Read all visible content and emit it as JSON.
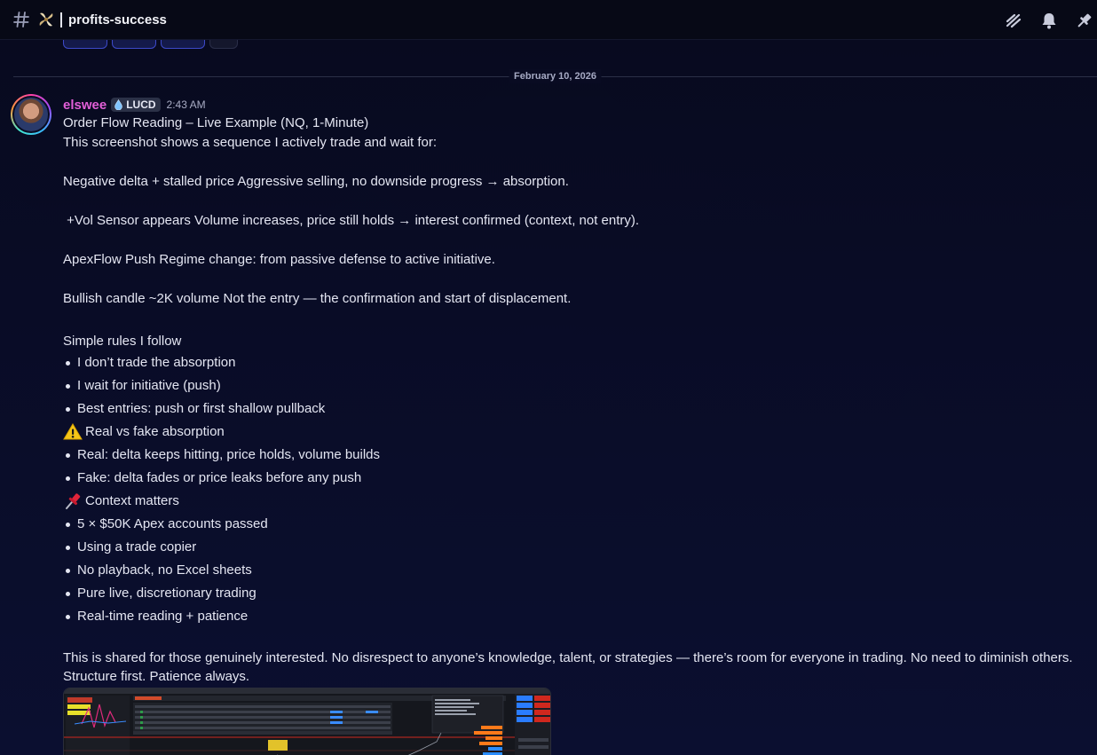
{
  "header": {
    "channel_icon": "hash-icon",
    "channel_emoji": "pinwheel-emoji",
    "channel_name": "profits-success",
    "actions": [
      "threads-icon",
      "bell-icon",
      "pin-icon"
    ]
  },
  "reactions": [
    {
      "emoji": "red-emoji"
    },
    {
      "emoji": "yellow-emoji"
    },
    {
      "emoji": "yellow-emoji"
    },
    {
      "emoji": "white-emoji"
    }
  ],
  "date_divider": "February 10, 2026",
  "message": {
    "author": "elswee",
    "role_tag": "LUCD",
    "timestamp": "2:43 AM",
    "lines": [
      "Order Flow Reading – Live Example (NQ, 1-Minute)",
      "This screenshot shows a sequence I actively trade and wait for:",
      "Negative delta + stalled price Aggressive selling, no downside progress → absorption.",
      " +Vol Sensor appears Volume increases, price still holds → interest confirmed (context, not entry).",
      "ApexFlow Push Regime change: from passive defense to active initiative.",
      "Bullish candle ~2K volume Not the entry — the confirmation and start of displacement.",
      "Simple rules I follow"
    ],
    "rules": [
      "I don’t trade the absorption",
      "I wait for initiative (push)",
      "Best entries: push or first shallow pullback"
    ],
    "absorption_heading": "Real vs fake absorption",
    "absorption_items": [
      "Real: delta keeps hitting, price holds, volume builds",
      "Fake: delta fades or price leaks before any push"
    ],
    "context_heading": "Context matters",
    "context_items": [
      "5 × $50K Apex accounts passed",
      "Using a trade copier",
      "No playback, no Excel sheets",
      "Pure live, discretionary trading",
      "Real-time reading + patience"
    ],
    "closing_1": "This is shared for those genuinely interested. No disrespect to anyone’s knowledge, talent, or strategies — there’s room for everyone in trading. No need to diminish others.",
    "closing_2": "Structure first. Patience always."
  },
  "attachment": {
    "type": "trading-platform-screenshot"
  },
  "colors": {
    "username": "#e25fd8",
    "accent": "#3c49c8",
    "background": "#090c26"
  }
}
